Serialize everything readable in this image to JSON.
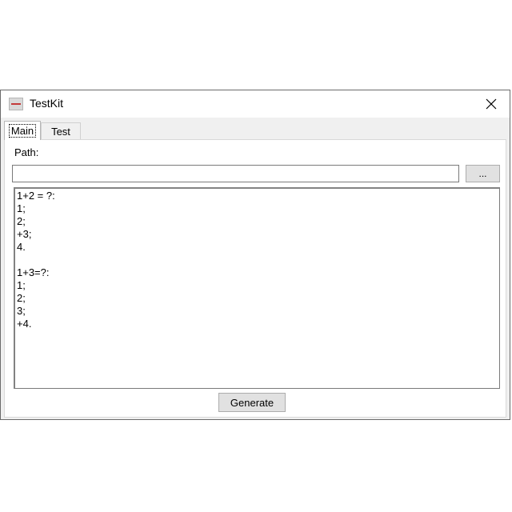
{
  "window": {
    "title": "TestKit"
  },
  "tabs": [
    {
      "label": "Main",
      "active": true
    },
    {
      "label": "Test",
      "active": false
    }
  ],
  "main": {
    "path_label": "Path:",
    "path_value": "",
    "browse_label": "...",
    "output_text": "1+2 = ?:\n1;\n2;\n+3;\n4.\n\n1+3=?:\n1;\n2;\n3;\n+4.",
    "generate_label": "Generate"
  },
  "icons": {
    "app": "testkit-app-icon",
    "close": "close-icon"
  }
}
